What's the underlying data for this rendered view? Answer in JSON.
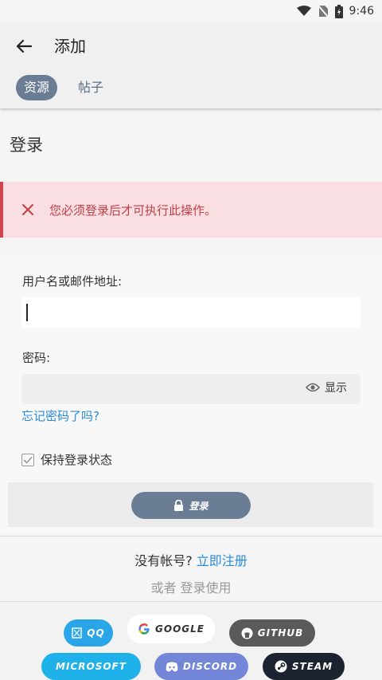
{
  "status_bar": {
    "time": "9:46"
  },
  "app_bar": {
    "title": "添加",
    "tabs": [
      {
        "label": "资源",
        "active": true
      },
      {
        "label": "帖子",
        "active": false
      }
    ]
  },
  "login": {
    "section_title": "登录",
    "error_message": "您必须登录后才可执行此操作。",
    "username_label": "用户名或邮件地址:",
    "username_value": "",
    "password_label": "密码:",
    "password_value": "",
    "show_password_label": "显示",
    "forgot_password_link": "忘记密码了吗?",
    "remember_label": "保持登录状态",
    "remember_checked": true,
    "submit_label": "登录"
  },
  "signup": {
    "prompt": "没有帐号?",
    "link": "立即注册",
    "alt_prefix": "或者",
    "alt_text": "登录使用"
  },
  "social_logins": [
    {
      "label": "QQ",
      "color": "#2aa6e8"
    },
    {
      "label": "GOOGLE",
      "color": "#ffffff"
    },
    {
      "label": "GITHUB",
      "color": "#5a5a5a"
    },
    {
      "label": "MICROSOFT",
      "color": "#1fb2ea"
    },
    {
      "label": "DISCORD",
      "color": "#7486d8"
    },
    {
      "label": "STEAM",
      "color": "#1c2230"
    }
  ],
  "colors": {
    "accent": "#6a7d95",
    "link": "#2a8bd8",
    "error_bg": "#f9dfe1",
    "error_text": "#c0404a"
  }
}
